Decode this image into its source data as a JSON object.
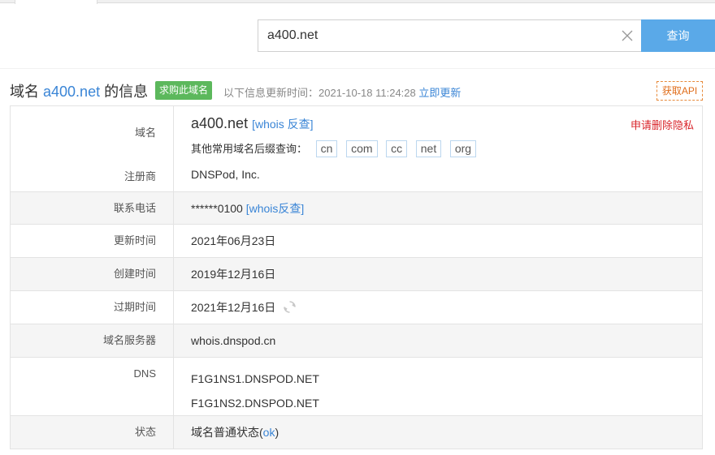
{
  "search": {
    "value": "a400.net",
    "button_label": "查询"
  },
  "heading": {
    "prefix": "域名",
    "domain": "a400.net",
    "suffix": "的信息",
    "buy_badge": "求购此域名",
    "update_prefix": "以下信息更新时间：2021-10-18 11:24:28",
    "update_link": "立即更新",
    "api_button": "获取API"
  },
  "info": {
    "domain_label": "域名",
    "domain_value": "a400.net",
    "whois_reverse": "[whois 反查]",
    "privacy_link": "申请删除隐私",
    "suffix_prompt": "其他常用域名后缀查询：",
    "suffixes": [
      "cn",
      "com",
      "cc",
      "net",
      "org"
    ],
    "registrar_label": "注册商",
    "registrar_value": "DNSPod, Inc.",
    "phone_label": "联系电话",
    "phone_value": "******0100",
    "phone_whois": "[whois反查]",
    "updated_label": "更新时间",
    "updated_value": "2021年06月23日",
    "created_label": "创建时间",
    "created_value": "2019年12月16日",
    "expires_label": "过期时间",
    "expires_value": "2021年12月16日",
    "nameserver_label": "域名服务器",
    "nameserver_value": "whois.dnspod.cn",
    "dns_label": "DNS",
    "dns_values": [
      "F1G1NS1.DNSPOD.NET",
      "F1G1NS2.DNSPOD.NET"
    ],
    "status_label": "状态",
    "status_prefix": "域名普通状态(",
    "status_link": "ok",
    "status_suffix": ")"
  },
  "icons": {
    "clear": "close-icon",
    "refresh": "refresh-icon"
  },
  "colors": {
    "accent": "#3a85d6",
    "search_button": "#5aa9e8",
    "buy_badge": "#5cb85c",
    "privacy": "#d9262c",
    "api_border": "#e78a3b"
  }
}
